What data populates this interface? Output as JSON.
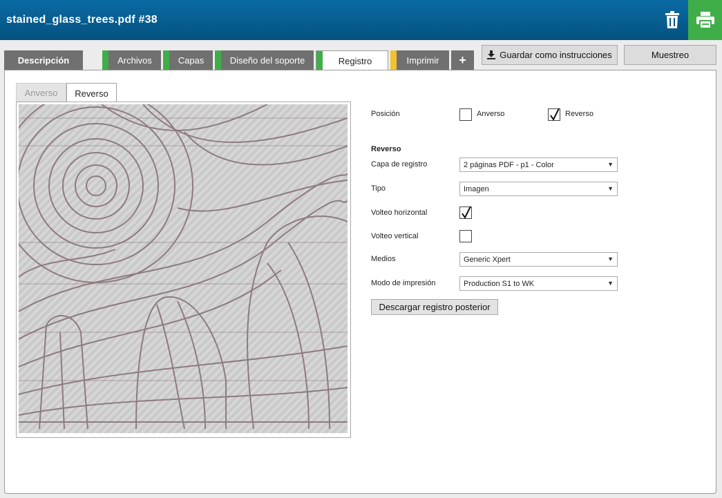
{
  "window": {
    "title": "stained_glass_trees.pdf #38"
  },
  "tabs": [
    {
      "label": "Descripción"
    },
    {
      "label": "Archivos"
    },
    {
      "label": "Capas"
    },
    {
      "label": "Diseño del soporte"
    },
    {
      "label": "Registro"
    },
    {
      "label": "Imprimir"
    },
    {
      "label": "+"
    }
  ],
  "toolbar": {
    "save_label": "Guardar como instrucciones",
    "sample_label": "Muestreo"
  },
  "subtabs": [
    {
      "label": "Anverso"
    },
    {
      "label": "Reverso"
    }
  ],
  "form": {
    "position_label": "Posición",
    "front_option": "Anverso",
    "back_option": "Reverso",
    "section_title": "Reverso",
    "layer_label": "Capa de registro",
    "layer_value": "2 páginas PDF - p1 - Color",
    "type_label": "Tipo",
    "type_value": "Imagen",
    "hflip_label": "Volteo horizontal",
    "vflip_label": "Volteo vertical",
    "media_label": "Medios",
    "media_value": "Generic Xpert",
    "print_mode_label": "Modo de impresión",
    "print_mode_value": "Production S1 to WK",
    "download_label": "Descargar registro posterior"
  },
  "state": {
    "front_checked": false,
    "back_checked": true,
    "hflip_checked": true,
    "vflip_checked": false
  },
  "colors": {
    "header": "#04527f",
    "print_green": "#3fae49",
    "tab_green": "#3fae49",
    "tab_yellow": "#f2c12e"
  }
}
